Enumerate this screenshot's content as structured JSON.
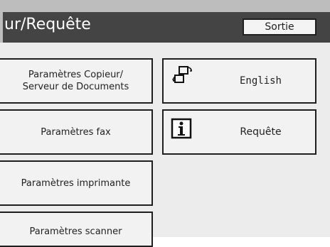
{
  "header": {
    "title": "ur/Requête",
    "exit_label": "Sortie"
  },
  "left_buttons": [
    {
      "label": "Paramètres Copieur/\nServeur de Documents"
    },
    {
      "label": "Paramètres fax"
    },
    {
      "label": "Paramètres imprimante"
    },
    {
      "label": "Paramètres scanner"
    }
  ],
  "right_buttons": [
    {
      "label": "English",
      "icon": "language-switch-icon"
    },
    {
      "label": "Requête",
      "icon": "info-icon"
    }
  ]
}
